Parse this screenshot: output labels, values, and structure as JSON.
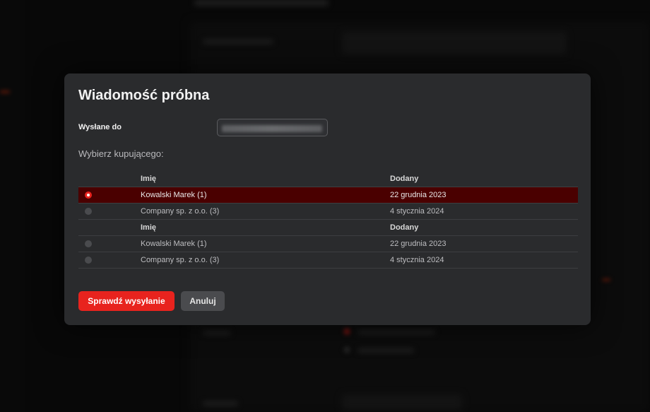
{
  "modal": {
    "title": "Wiadomość próbna",
    "sent_to_label": "Wysłane do",
    "sent_to_value": "",
    "choose_buyer_label": "Wybierz kupującego:",
    "tables": [
      {
        "columns": [
          "Imię",
          "Dodany"
        ],
        "rows": [
          {
            "name": "Kowalski Marek (1)",
            "added": "22 grudnia 2023",
            "selected": true
          },
          {
            "name": "Company sp. z o.o. (3)",
            "added": "4 stycznia 2024",
            "selected": false
          }
        ]
      },
      {
        "columns": [
          "Imię",
          "Dodany"
        ],
        "rows": [
          {
            "name": "Kowalski Marek (1)",
            "added": "22 grudnia 2023",
            "selected": false
          },
          {
            "name": "Company sp. z o.o. (3)",
            "added": "4 stycznia 2024",
            "selected": false
          }
        ]
      }
    ],
    "primary_button": "Sprawdź wysyłanie",
    "cancel_button": "Anuluj"
  },
  "colors": {
    "accent": "#e8231e",
    "selected_row": "#4a0000",
    "modal_bg": "#2a2b2d"
  }
}
